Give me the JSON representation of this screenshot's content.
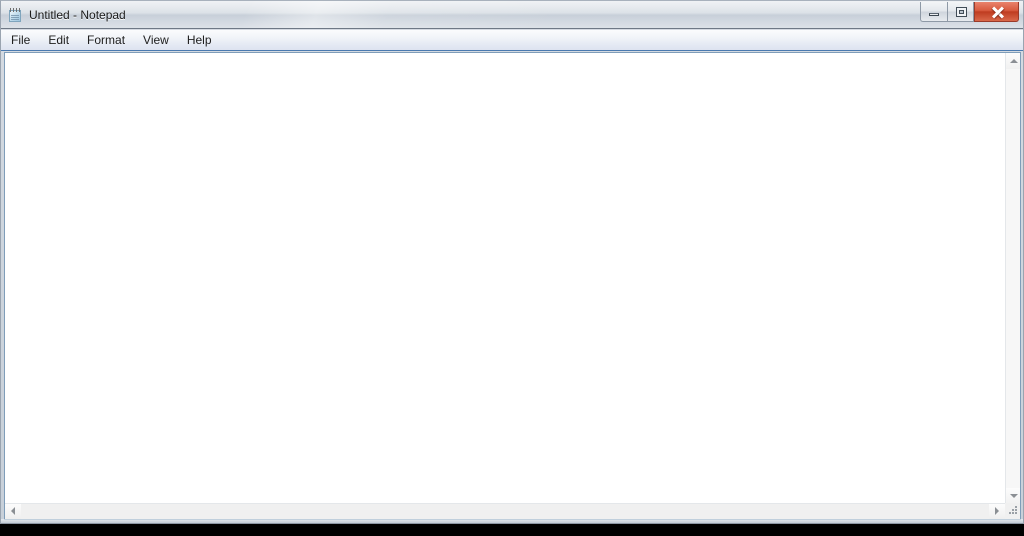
{
  "window": {
    "title": "Untitled - Notepad",
    "app_icon": "notepad-icon",
    "controls": {
      "minimize_label": "Minimize",
      "maximize_label": "Restore Down",
      "close_label": "Close"
    }
  },
  "menubar": {
    "items": [
      {
        "label": "File"
      },
      {
        "label": "Edit"
      },
      {
        "label": "Format"
      },
      {
        "label": "View"
      },
      {
        "label": "Help"
      }
    ]
  },
  "editor": {
    "content": "",
    "placeholder": ""
  },
  "scrollbars": {
    "vertical": {
      "up_arrow": "scroll-up-icon",
      "down_arrow": "scroll-down-icon"
    },
    "horizontal": {
      "left_arrow": "scroll-left-icon",
      "right_arrow": "scroll-right-icon"
    },
    "resize_grip": "resize-grip-icon"
  },
  "colors": {
    "titlebar": "#d3dae1",
    "menubar_accent": "#4a7ab0",
    "close_button": "#bf3c20",
    "client_border": "#7f9db9",
    "text_area": "#ffffff",
    "desktop": "#000000"
  }
}
